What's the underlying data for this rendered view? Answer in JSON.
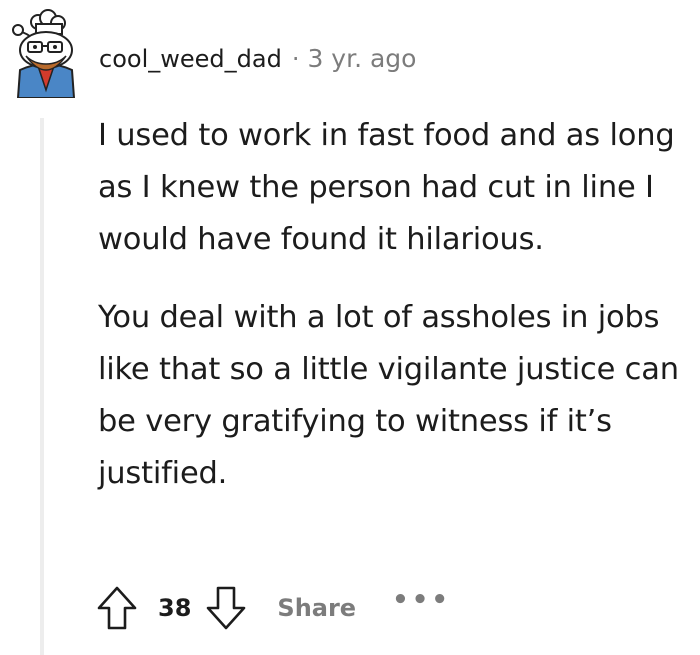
{
  "comment": {
    "author": "cool_weed_dad",
    "separator": "·",
    "timestamp": "3 yr. ago",
    "avatar_icon": "snoo-avatar-icon",
    "paragraphs": [
      "I used to work in fast food and as long as I knew the person had cut in line I would have found it hilarious.",
      "You deal with a lot of assholes in jobs like that so a little vigilante justice can be very gratifying to witness if it’s justified."
    ]
  },
  "actions": {
    "upvote_icon": "upvote-arrow-icon",
    "score": "38",
    "downvote_icon": "downvote-arrow-icon",
    "share_label": "Share",
    "more_label": "•••"
  },
  "colors": {
    "text": "#1c1c1c",
    "meta": "#7c7c7c",
    "thread_line": "#ededed"
  }
}
